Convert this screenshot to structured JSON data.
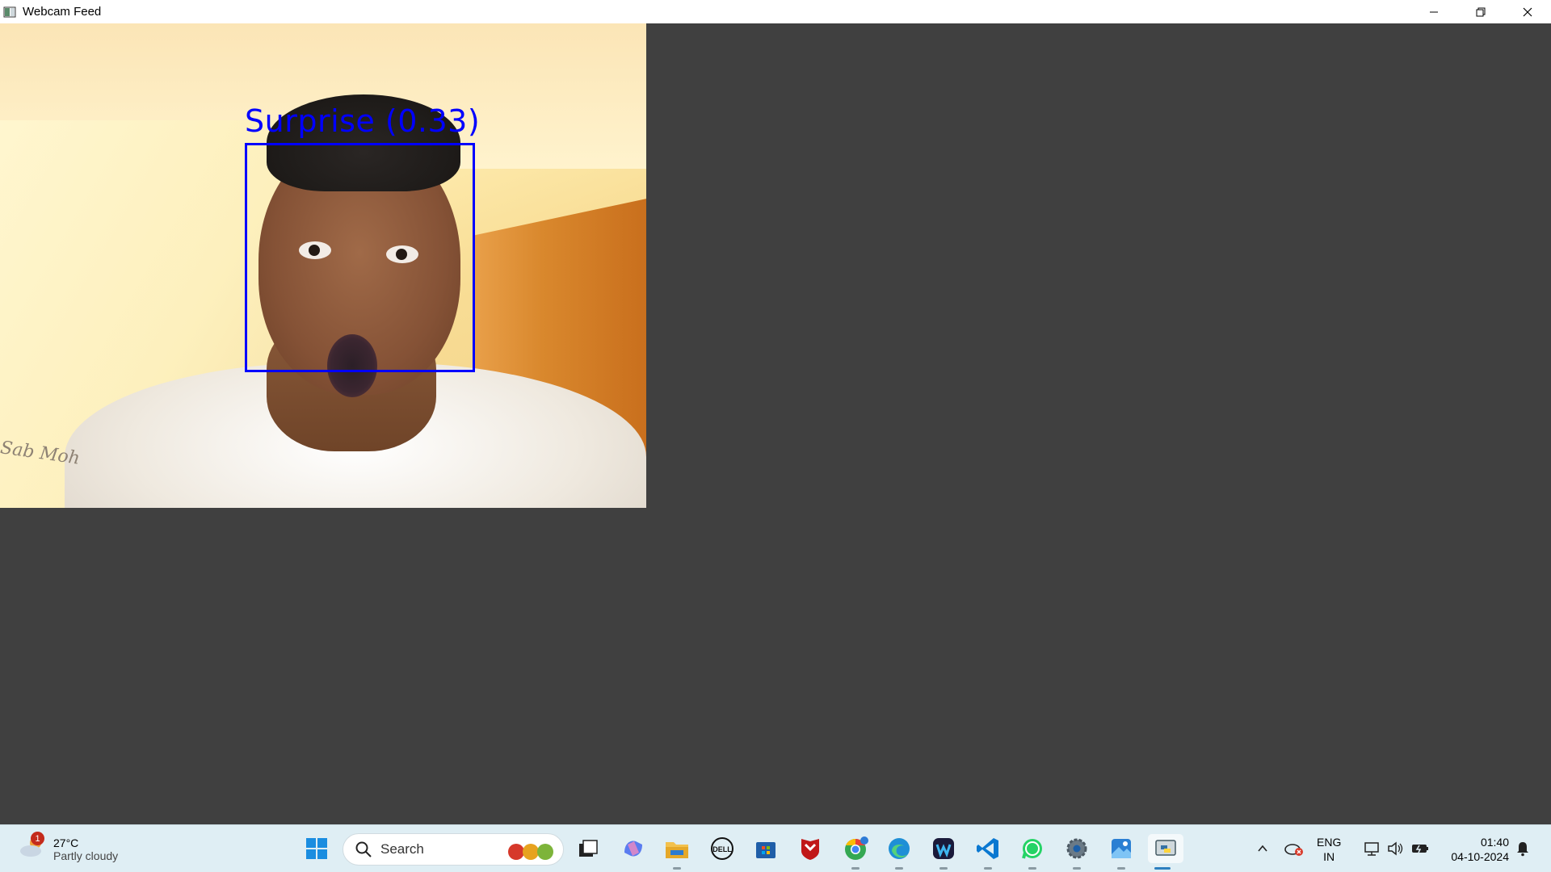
{
  "window": {
    "title": "Webcam Feed"
  },
  "detection": {
    "label": "Surprise (0.33)",
    "box_color": "#0000ff"
  },
  "scene": {
    "wall_text": "Sab Moh"
  },
  "taskbar": {
    "weather": {
      "temperature": "27°C",
      "description": "Partly cloudy",
      "badge": "1"
    },
    "search": {
      "placeholder": "Search"
    },
    "pinned": [
      "task-view-icon",
      "copilot-icon",
      "file-explorer-icon",
      "dell-icon",
      "microsoft-store-icon",
      "mcafee-icon",
      "chrome-icon",
      "edge-icon",
      "webex-icon",
      "vscode-icon",
      "whatsapp-icon",
      "settings-icon",
      "photos-icon",
      "python-icon"
    ],
    "tray": {
      "language_line1": "ENG",
      "language_line2": "IN",
      "time": "01:40",
      "date": "04-10-2024"
    },
    "accent_color": "#0078d4"
  }
}
